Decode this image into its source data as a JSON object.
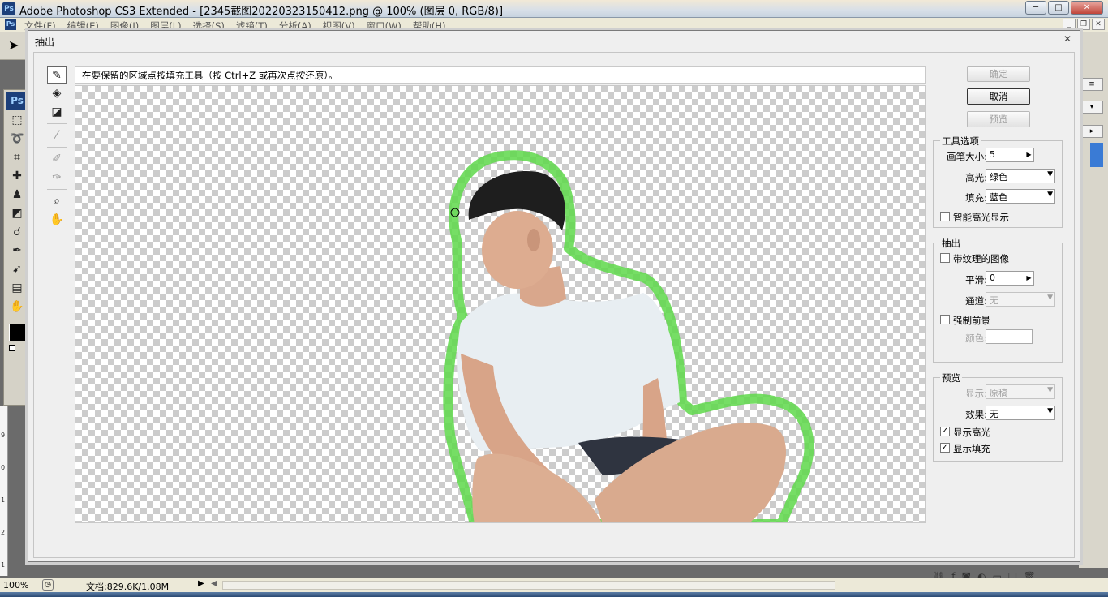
{
  "app": {
    "title": "Adobe Photoshop CS3 Extended - [2345截图20220323150412.png @ 100% (图层 0, RGB/8)]",
    "logo": "Ps",
    "window_buttons": [
      "─",
      "□",
      "✕"
    ]
  },
  "menu": {
    "items": [
      "文件(F)",
      "编辑(E)",
      "图像(I)",
      "图层(L)",
      "选择(S)",
      "滤镜(T)",
      "分析(A)",
      "视图(V)",
      "窗口(W)",
      "帮助(H)"
    ]
  },
  "toolbox": {
    "logo": "Ps"
  },
  "ruler": {
    "labels": [
      "9",
      "0",
      "1",
      "2",
      "1"
    ]
  },
  "status": {
    "zoom": "100%",
    "doc_info": "文档:829.6K/1.08M"
  },
  "dialog": {
    "title": "抽出",
    "hint": "在要保留的区域点按填充工具（按 Ctrl+Z 或再次点按还原）。",
    "buttons": {
      "ok": "确定",
      "cancel": "取消",
      "preview": "预览"
    },
    "tool_options": {
      "title": "工具选项",
      "brush_size_label": "画笔大小:",
      "brush_size": "5",
      "highlight_label": "高光:",
      "highlight_value": "绿色",
      "fill_label": "填充:",
      "fill_value": "蓝色",
      "smart_highlight": "智能高光显示"
    },
    "extraction": {
      "title": "抽出",
      "textured": "带纹理的图像",
      "smooth_label": "平滑:",
      "smooth_value": "0",
      "channel_label": "通道:",
      "channel_value": "无",
      "force_fg": "强制前景",
      "color_label": "颜色:"
    },
    "preview": {
      "title": "预览",
      "show_label": "显示:",
      "show_value": "原稿",
      "effect_label": "效果:",
      "effect_value": "无",
      "show_highlight": "显示高光",
      "show_fill": "显示填充",
      "show_highlight_checked": true,
      "show_fill_checked": true
    }
  },
  "colors": {
    "highlight_green": "#5ed84a",
    "shirt": "#e8eef2",
    "skin": "#d9a78c",
    "hair": "#1e1e1e"
  }
}
